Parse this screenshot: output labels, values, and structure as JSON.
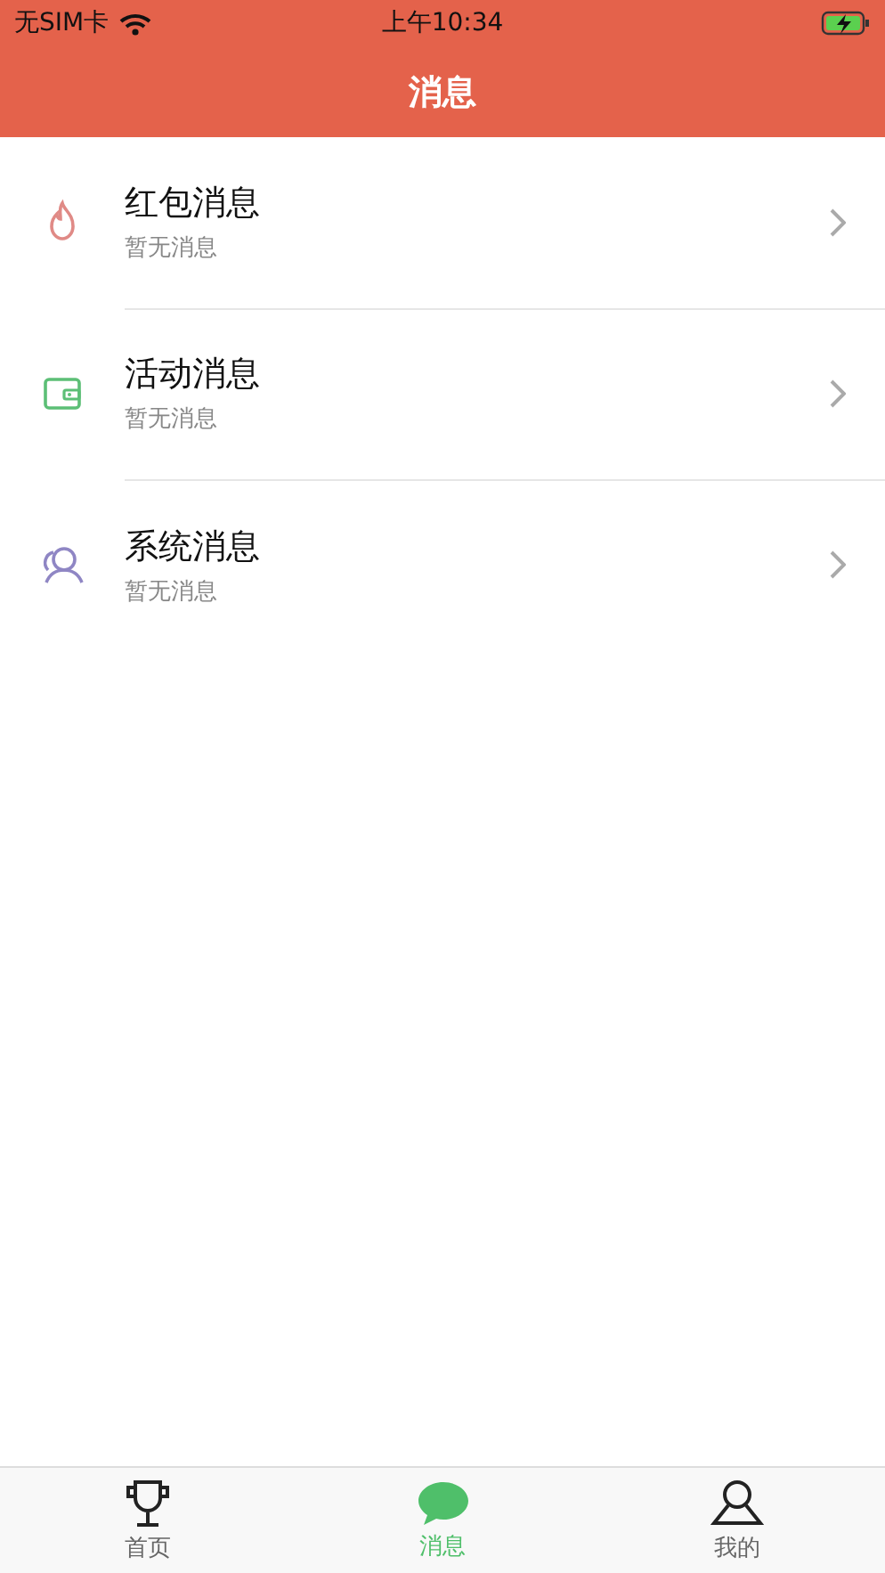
{
  "status_bar": {
    "carrier": "无SIM卡",
    "time": "上午10:34",
    "charging": true
  },
  "header": {
    "title": "消息"
  },
  "messages": [
    {
      "kind": "flame",
      "title": "红包消息",
      "subtitle": "暂无消息"
    },
    {
      "kind": "wallet",
      "title": "活动消息",
      "subtitle": "暂无消息"
    },
    {
      "kind": "people",
      "title": "系统消息",
      "subtitle": "暂无消息"
    }
  ],
  "tab_bar": [
    {
      "kind": "trophy",
      "label": "首页",
      "selected": false
    },
    {
      "kind": "chat",
      "label": "消息",
      "selected": true
    },
    {
      "kind": "person",
      "label": "我的",
      "selected": false
    }
  ]
}
